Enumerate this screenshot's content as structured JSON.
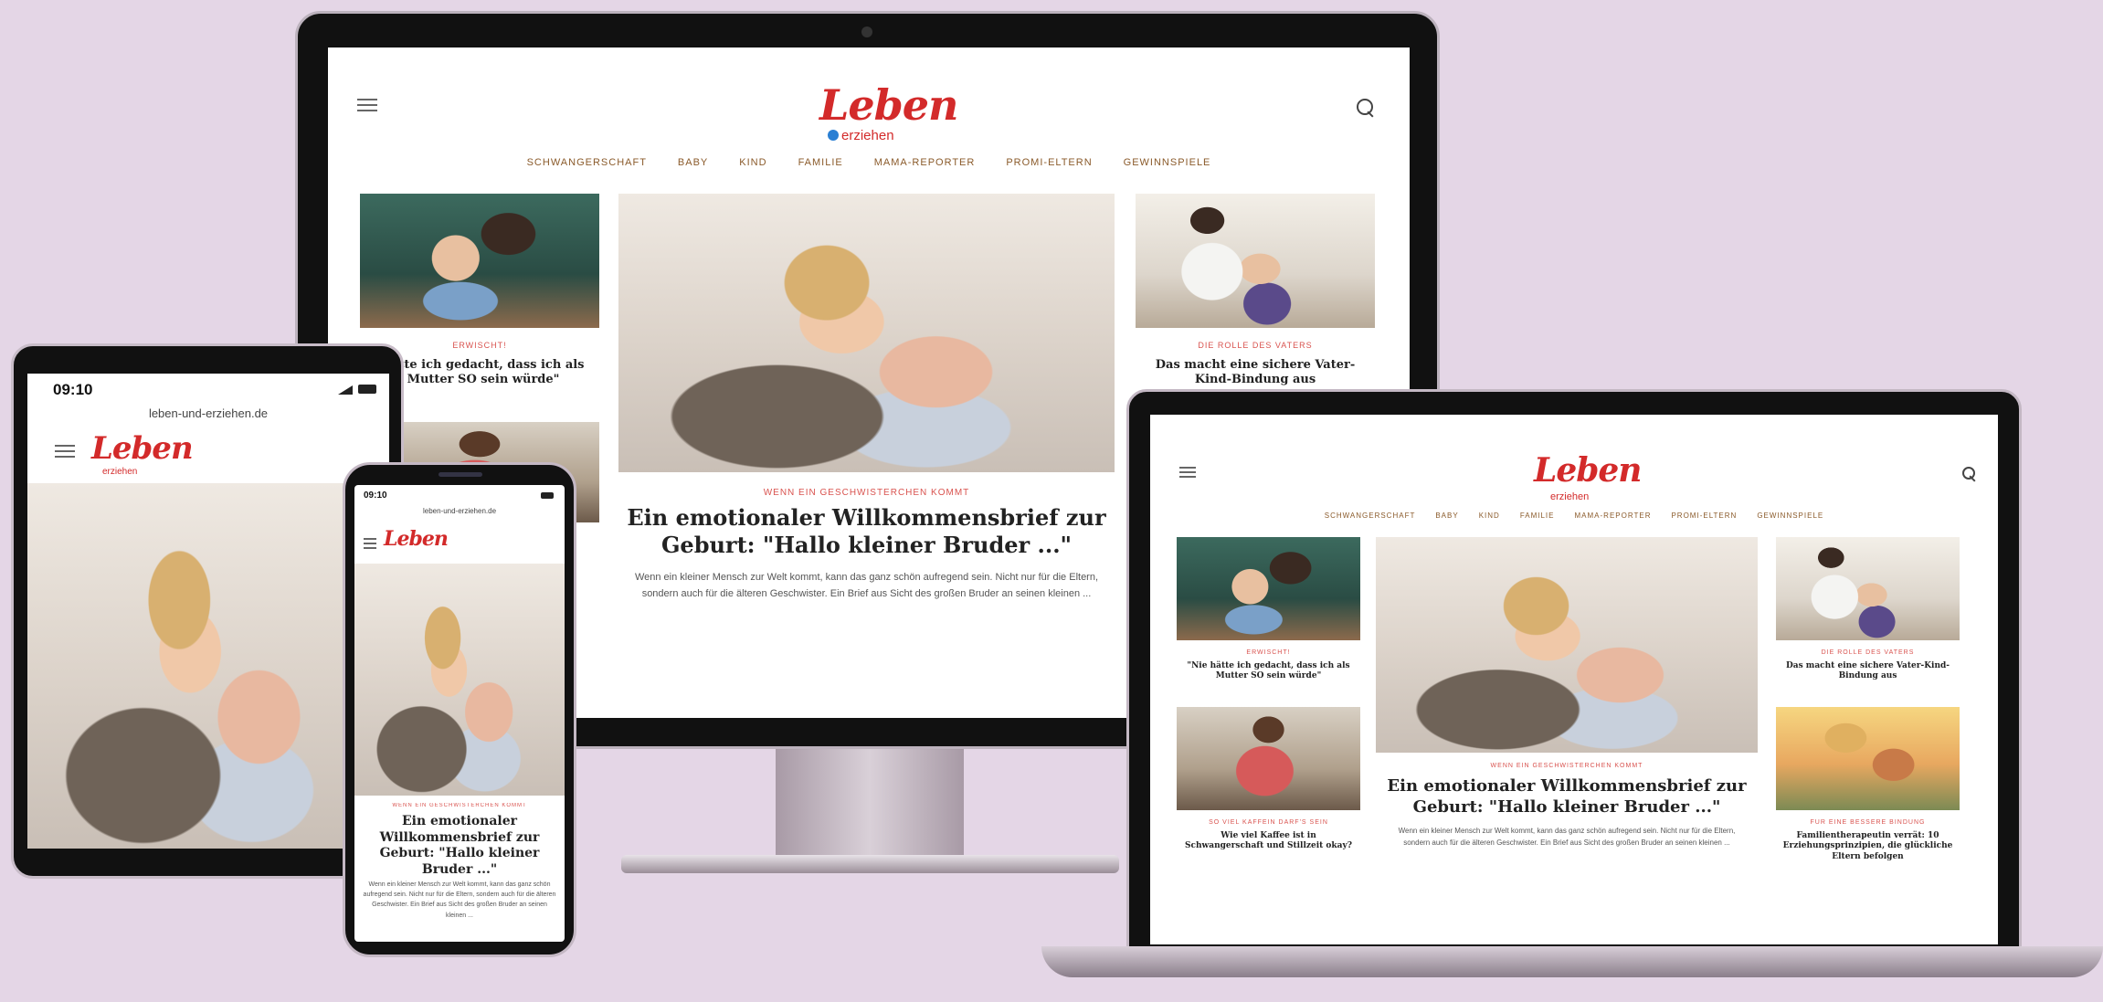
{
  "brand": {
    "logo": "Leben",
    "logo_sub": "erziehen",
    "accent": "#d32a2a",
    "nav_color": "#8a5a2a"
  },
  "nav": [
    "SCHWANGERSCHAFT",
    "BABY",
    "KIND",
    "FAMILIE",
    "MAMA-REPORTER",
    "PROMI-ELTERN",
    "GEWINNSPIELE"
  ],
  "hero": {
    "kicker": "WENN EIN GESCHWISTERCHEN KOMMT",
    "title": "Ein emotionaler Willkommensbrief zur Geburt: \"Hallo kleiner Bruder ...\"",
    "desc": "Wenn ein kleiner Mensch zur Welt kommt, kann das ganz schön aufregend sein. Nicht nur für die Eltern, sondern auch für die älteren Geschwister. Ein Brief aus Sicht des großen Bruder an seinen kleinen ..."
  },
  "cards": [
    {
      "kicker": "ERWISCHT!",
      "title": "\"Nie hätte ich gedacht, dass ich als Mutter SO sein würde\""
    },
    {
      "kicker": "DIE ROLLE DES VATERS",
      "title": "Das macht eine sichere Vater-Kind-Bindung aus"
    },
    {
      "kicker": "SO VIEL KAFFEIN DARF'S SEIN",
      "title": "Wie viel Kaffee ist in Schwangerschaft und Stillzeit okay?"
    },
    {
      "kicker": "FÜR EINE BESSERE BINDUNG",
      "title": "Familientherapeutin verrät: 10 Erziehungsprinzipien, die glückliche Eltern befolgen"
    }
  ],
  "desktop_cut": {
    "left_title": "hätte ich gedacht, dass ich als Mutter SO sein würde\""
  },
  "tablet": {
    "time": "09:10",
    "url": "leben-und-erziehen.de"
  },
  "phone": {
    "time": "09:10",
    "url": "leben-und-erziehen.de",
    "title": "Ein emotionaler Willkommensbrief zur Geburt: \"Hallo kleiner Bruder ...\"",
    "desc": "Wenn ein kleiner Mensch zur Welt kommt, kann das ganz schön aufregend sein. Nicht nur für die Eltern, sondern auch für die älteren Geschwister. Ein Brief aus Sicht des großen Bruder an seinen kleinen ..."
  }
}
